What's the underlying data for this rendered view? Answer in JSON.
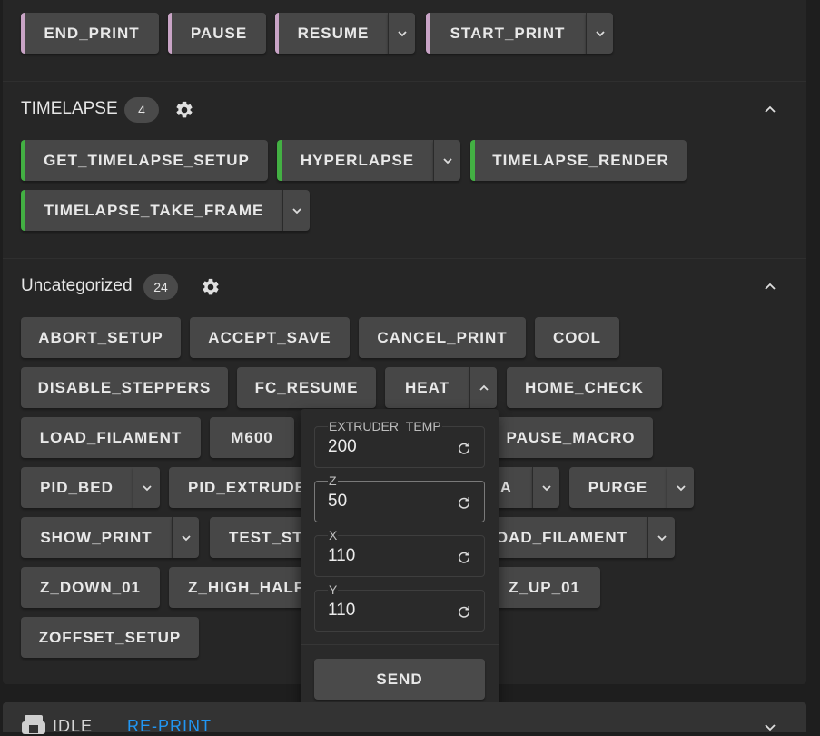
{
  "status_group": {
    "buttons": [
      {
        "label": "END_PRINT"
      },
      {
        "label": "PAUSE"
      },
      {
        "label": "RESUME"
      },
      {
        "label": "START_PRINT"
      }
    ]
  },
  "timelapse": {
    "title": "TIMELAPSE",
    "count": "4",
    "buttons": [
      {
        "label": "GET_TIMELAPSE_SETUP"
      },
      {
        "label": "HYPERLAPSE"
      },
      {
        "label": "TIMELAPSE_RENDER"
      },
      {
        "label": "TIMELAPSE_TAKE_FRAME"
      }
    ]
  },
  "uncategorized": {
    "title": "Uncategorized",
    "count": "24",
    "buttons": [
      {
        "label": "ABORT_SETUP"
      },
      {
        "label": "ACCEPT_SAVE"
      },
      {
        "label": "CANCEL_PRINT"
      },
      {
        "label": "COOL"
      },
      {
        "label": "DISABLE_STEPPERS"
      },
      {
        "label": "FC_RESUME"
      },
      {
        "label": "HEAT"
      },
      {
        "label": "HOME_CHECK"
      },
      {
        "label": "LOAD_FILAMENT"
      },
      {
        "label": "M600"
      },
      {
        "label": "PAUSE_MACRO"
      },
      {
        "label": "PID_BED"
      },
      {
        "label": "PID_EXTRUDE"
      },
      {
        "label": "A"
      },
      {
        "label": "PURGE"
      },
      {
        "label": "SHOW_PRINT"
      },
      {
        "label": "TEST_ST"
      },
      {
        "label": "OAD_FILAMENT"
      },
      {
        "label": "Z_DOWN_01"
      },
      {
        "label": "Z_HIGH_HALF"
      },
      {
        "label": "Z_UP_01"
      },
      {
        "label": "ZOFFSET_SETUP"
      }
    ]
  },
  "heat_popup": {
    "fields": [
      {
        "label": "EXTRUDER_TEMP",
        "value": "200"
      },
      {
        "label": "Z",
        "value": "50"
      },
      {
        "label": "X",
        "value": "110"
      },
      {
        "label": "Y",
        "value": "110"
      }
    ],
    "send_label": "SEND"
  },
  "bottom_bar": {
    "status": "IDLE",
    "reprint_label": "RE-PRINT"
  },
  "colors": {
    "accent_pink": "#c9a4c6",
    "accent_green": "#43b043",
    "link_blue": "#2196f3"
  }
}
